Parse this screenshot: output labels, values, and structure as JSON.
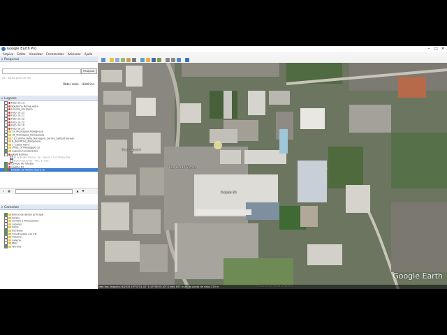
{
  "window": {
    "title": "Google Earth Pro",
    "controls": {
      "minimize": "–",
      "maximize": "□",
      "close": "×"
    }
  },
  "menu": [
    "Arquivo",
    "Editar",
    "Visualizar",
    "Ferramentas",
    "Adicionar",
    "Ajuda"
  ],
  "search": {
    "header": "Pesquisar",
    "placeholder": "",
    "button": "Pesquisar",
    "hint": "ex.: Hotéis perto de JFK",
    "links": [
      "Obter rotas",
      "Histórico"
    ]
  },
  "places": {
    "header": "Lugares",
    "items": [
      {
        "label": "Foto 10.13",
        "kind": "pin",
        "checked": false,
        "sub": false
      },
      {
        "label": "Spejtelna Remquadra",
        "kind": "pin",
        "checked": false,
        "sub": false
      },
      {
        "label": "Lonelle_Escolano",
        "kind": "pin",
        "checked": false,
        "sub": false
      },
      {
        "label": "Foto 10.21",
        "kind": "pin",
        "checked": false,
        "sub": false
      },
      {
        "label": "Foto 10.21",
        "kind": "pin",
        "checked": false,
        "sub": false
      },
      {
        "label": "Foto 10.22",
        "kind": "pin",
        "checked": false,
        "sub": false
      },
      {
        "label": "Foto 10.22",
        "kind": "pin",
        "checked": false,
        "sub": false
      },
      {
        "label": "Foto 10.10",
        "kind": "pin",
        "checked": false,
        "sub": false
      },
      {
        "label": "Foto 10.19",
        "kind": "pin",
        "checked": false,
        "sub": false
      },
      {
        "label": "19_Montagna_Bolognese",
        "kind": "folder",
        "checked": false,
        "sub": false
      },
      {
        "label": "18_Montagna_Romagnola",
        "kind": "folder",
        "checked": false,
        "sub": false
      },
      {
        "label": "11_Collina_della_Romagna_Centro_Settentrionale",
        "kind": "folder",
        "checked": false,
        "sub": false
      },
      {
        "label": "8_Bonifiche_Bolognese",
        "kind": "folder",
        "checked": false,
        "sub": false
      },
      {
        "label": "1_Costa_Nord",
        "kind": "folder",
        "checked": false,
        "sub": false
      },
      {
        "label": "Unita_di_Paesaggio_pl",
        "kind": "folder",
        "checked": false,
        "sub": false
      },
      {
        "label": "Lugares temporários",
        "kind": "folder",
        "checked": true,
        "sub": false
      },
      {
        "label": "GKSB Barista",
        "kind": "pin",
        "checked": false,
        "sub": false
      },
      {
        "label": "Rua Barão Viçosa, Sp - Santa Cruz Pampulha",
        "kind": "none",
        "checked": false,
        "sub": true
      },
      {
        "label": "Belo Horizonte - MG, 31310",
        "kind": "none",
        "checked": false,
        "sub": true
      },
      {
        "label": "Campo de futebol",
        "kind": "pin",
        "checked": true,
        "sub": false
      },
      {
        "label": "Galpão 62",
        "kind": "pin",
        "checked": true,
        "sub": false
      },
      {
        "label": "Estádio do Vitório Vieira-sk",
        "kind": "pin",
        "checked": true,
        "sub": false,
        "selected": true
      }
    ]
  },
  "layers": {
    "header": "Camadas",
    "items": [
      {
        "label": "Banco de dados principal",
        "kind": "folder",
        "checked": true
      },
      {
        "label": "Avisos",
        "kind": "folder",
        "checked": false
      },
      {
        "label": "Limites e Marcadores",
        "kind": "folder",
        "checked": false
      },
      {
        "label": "Lugares",
        "kind": "folder",
        "checked": false
      },
      {
        "label": "Fotos",
        "kind": "folder",
        "checked": false
      },
      {
        "label": "Estradas",
        "kind": "folder",
        "checked": true
      },
      {
        "label": "Construções em 3D",
        "kind": "folder",
        "checked": true
      },
      {
        "label": "Oceano",
        "kind": "folder",
        "checked": false
      },
      {
        "label": "Galeria",
        "kind": "folder",
        "checked": false
      },
      {
        "label": "Mais",
        "kind": "folder",
        "checked": false
      },
      {
        "label": "Terreno",
        "kind": "folder",
        "checked": true
      }
    ]
  },
  "map": {
    "labels": [
      "Rua Barão Viçosa",
      "Rua Guarani",
      "Galpão 62",
      "Estádio do Vitório Vieira"
    ],
    "watermark": "Google Earth",
    "status": "Data das imagens: 6/2019   19°52'51.42\" S  43°56'55.10\" O  elev 853 m  alt do ponto de visão 320 m"
  },
  "colors": {
    "selected": "#3a7fd0",
    "panel_header": "#dfe7f2",
    "pin": "#d33333"
  }
}
